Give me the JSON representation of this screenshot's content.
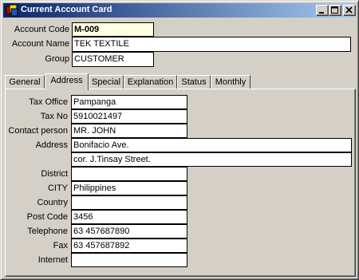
{
  "window": {
    "title": "Current Account Card"
  },
  "header": {
    "account_code_label": "Account Code",
    "account_code_value": "M-009",
    "account_name_label": "Account Name",
    "account_name_value": "TEK TEXTILE",
    "group_label": "Group",
    "group_value": "CUSTOMER"
  },
  "tabs": [
    {
      "label": "General"
    },
    {
      "label": "Address"
    },
    {
      "label": "Special"
    },
    {
      "label": "Explanation"
    },
    {
      "label": "Status"
    },
    {
      "label": "Monthly"
    }
  ],
  "active_tab": "Address",
  "address": {
    "tax_office_label": "Tax Office",
    "tax_office_value": "Pampanga",
    "tax_no_label": "Tax No",
    "tax_no_value": "5910021497",
    "contact_label": "Contact person",
    "contact_value": "MR. JOHN",
    "address_label": "Address",
    "address_line1": "Bonifacio Ave.",
    "address_line2": "cor. J.Tinsay Street.",
    "district_label": "District",
    "district_value": "",
    "city_label": "CITY",
    "city_value": "Philippines",
    "country_label": "Country",
    "country_value": "",
    "post_code_label": "Post Code",
    "post_code_value": "3456",
    "telephone_label": "Telephone",
    "telephone_value": "63 457687890",
    "fax_label": "Fax",
    "fax_value": "63 457687892",
    "internet_label": "Internet",
    "internet_value": ""
  },
  "icons": {
    "app": "app-icon",
    "minimize": "minimize-icon",
    "maximize": "maximize-icon",
    "close": "close-icon"
  },
  "colors": {
    "titlebar_start": "#0a246a",
    "titlebar_end": "#a6caf0",
    "highlight_field": "#ffffe1",
    "face": "#d4d0c8"
  }
}
